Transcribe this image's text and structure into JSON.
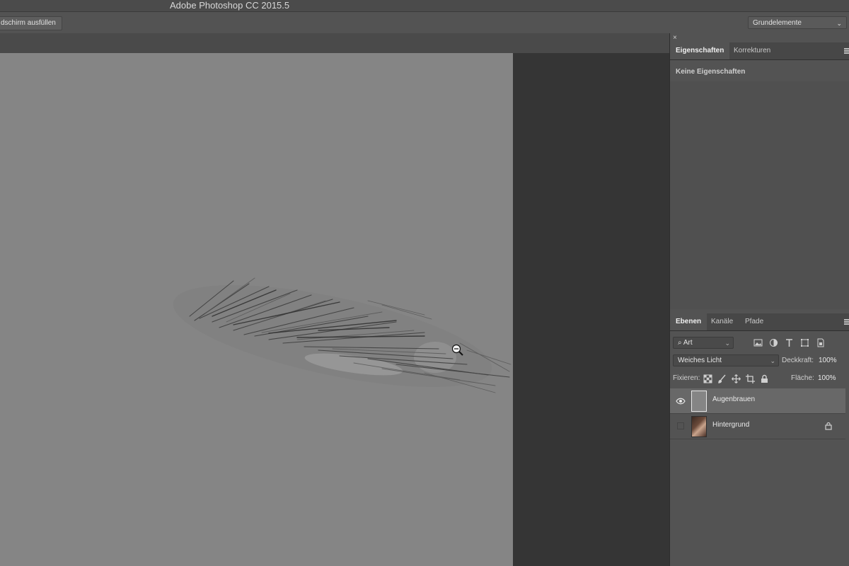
{
  "app": {
    "title": "Adobe Photoshop CC 2015.5"
  },
  "options_bar": {
    "fill_screen_label": "dschirm ausfüllen",
    "workspace_label": "Grundelemente"
  },
  "properties_panel": {
    "tabs": [
      {
        "label": "Eigenschaften",
        "active": true
      },
      {
        "label": "Korrekturen",
        "active": false
      }
    ],
    "empty_text": "Keine Eigenschaften"
  },
  "layers_panel": {
    "tabs": [
      {
        "label": "Ebenen",
        "active": true
      },
      {
        "label": "Kanäle",
        "active": false
      },
      {
        "label": "Pfade",
        "active": false
      }
    ],
    "filter_label": "Art",
    "blend_mode": "Weiches Licht",
    "opacity_label": "Deckkraft:",
    "opacity_value": "100%",
    "lock_label": "Fixieren:",
    "fill_label": "Fläche:",
    "fill_value": "100%",
    "layers": [
      {
        "name": "Augenbrauen",
        "visible": true,
        "selected": true,
        "locked": false
      },
      {
        "name": "Hintergrund",
        "visible": false,
        "selected": false,
        "locked": true
      }
    ]
  },
  "icons": [
    "close-icon",
    "search-icon",
    "image-filter-icon",
    "adjustment-filter-icon",
    "type-filter-icon",
    "shape-filter-icon",
    "smart-object-filter-icon",
    "lock-transparency-icon",
    "lock-brush-icon",
    "lock-move-icon",
    "lock-artboard-icon",
    "lock-all-icon",
    "eye-icon",
    "lock-icon",
    "zoom-out-cursor-icon"
  ],
  "colors": {
    "canvas_gray": "#858585",
    "panel_bg": "#535353",
    "selected_layer": "#686868"
  }
}
